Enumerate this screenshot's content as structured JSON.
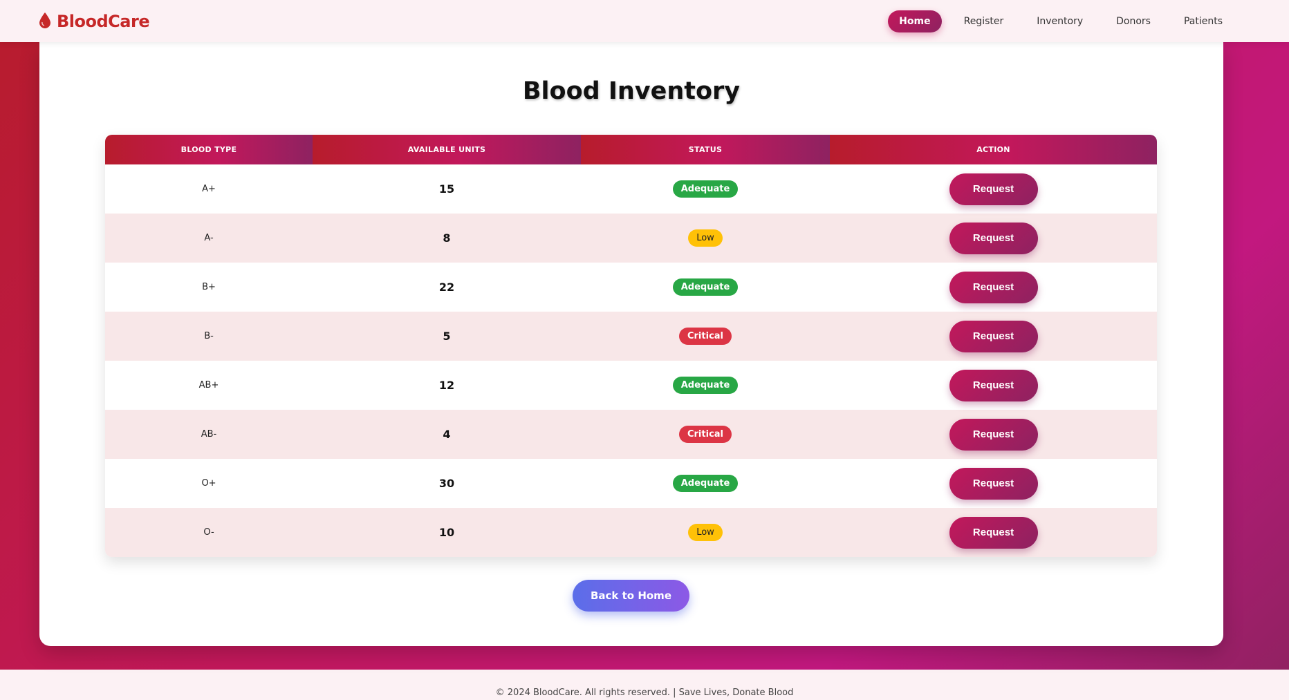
{
  "brand": {
    "name": "BloodCare",
    "logo_icon": "blood-drop-icon",
    "color": "#c62828"
  },
  "nav": {
    "items": [
      {
        "label": "Home",
        "active": true
      },
      {
        "label": "Register",
        "active": false
      },
      {
        "label": "Inventory",
        "active": false
      },
      {
        "label": "Donors",
        "active": false
      },
      {
        "label": "Patients",
        "active": false
      }
    ]
  },
  "page": {
    "title": "Blood Inventory"
  },
  "table": {
    "headers": [
      "Blood Type",
      "Available Units",
      "Status",
      "Action"
    ],
    "rows": [
      {
        "type": "A+",
        "units": "15",
        "status": "Adequate",
        "status_kind": "adequate",
        "action": "Request"
      },
      {
        "type": "A-",
        "units": "8",
        "status": "Low",
        "status_kind": "low",
        "action": "Request"
      },
      {
        "type": "B+",
        "units": "22",
        "status": "Adequate",
        "status_kind": "adequate",
        "action": "Request"
      },
      {
        "type": "B-",
        "units": "5",
        "status": "Critical",
        "status_kind": "critical",
        "action": "Request"
      },
      {
        "type": "AB+",
        "units": "12",
        "status": "Adequate",
        "status_kind": "adequate",
        "action": "Request"
      },
      {
        "type": "AB-",
        "units": "4",
        "status": "Critical",
        "status_kind": "critical",
        "action": "Request"
      },
      {
        "type": "O+",
        "units": "30",
        "status": "Adequate",
        "status_kind": "adequate",
        "action": "Request"
      },
      {
        "type": "O-",
        "units": "10",
        "status": "Low",
        "status_kind": "low",
        "action": "Request"
      }
    ]
  },
  "back_button": {
    "label": "Back to Home"
  },
  "footer": {
    "text": "© 2024 BloodCare. All rights reserved. | Save Lives, Donate Blood"
  },
  "colors": {
    "adequate": "#28a745",
    "low": "#ffc107",
    "critical": "#dc3545",
    "accent": "#c2185b"
  }
}
